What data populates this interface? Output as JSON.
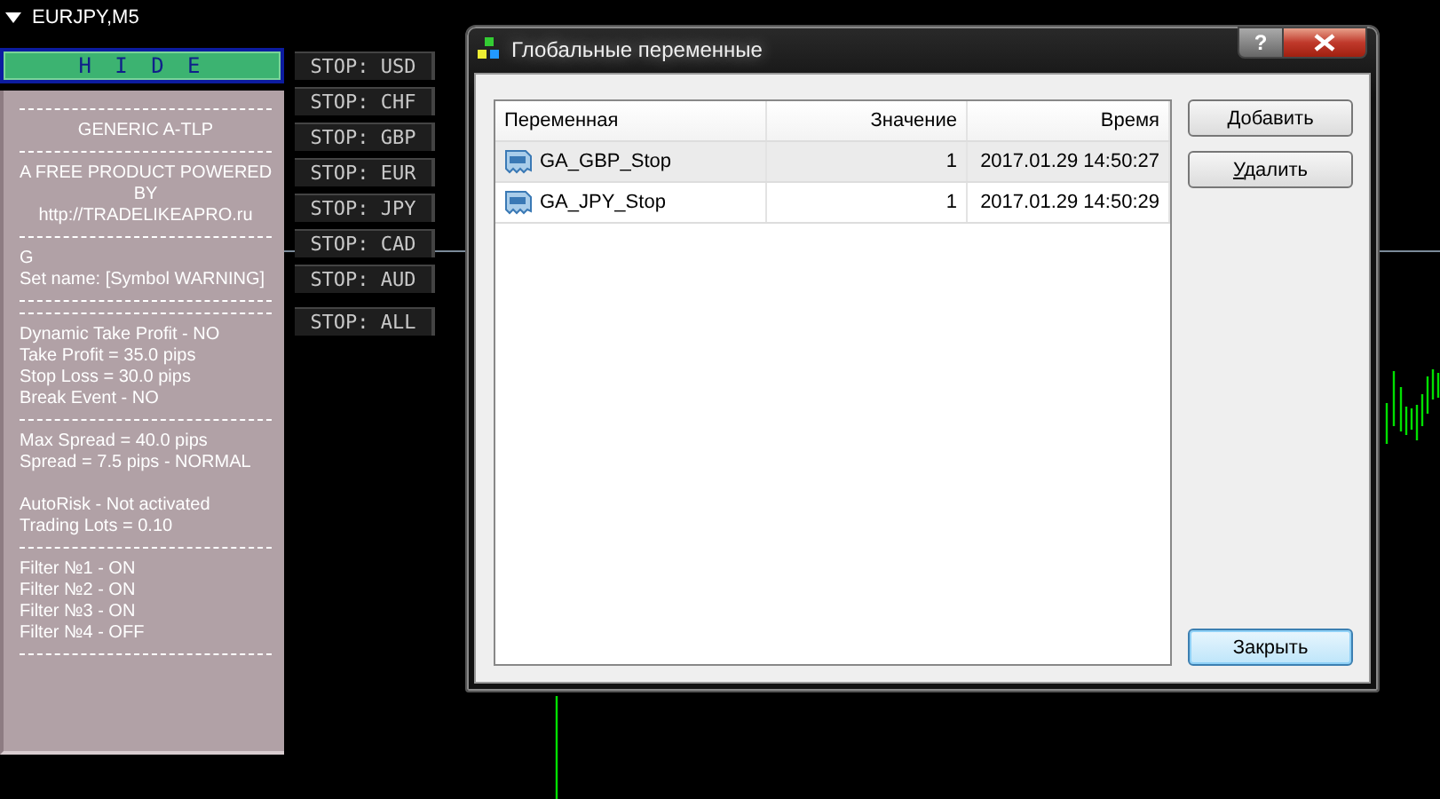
{
  "chart": {
    "title": "EURJPY,M5"
  },
  "hide_button": {
    "label": "H I D E"
  },
  "info_panel": {
    "lines": [
      {
        "kind": "rule"
      },
      {
        "kind": "center",
        "text": "GENERIC A-TLP"
      },
      {
        "kind": "rule"
      },
      {
        "kind": "center",
        "text": "A FREE PRODUCT POWERED"
      },
      {
        "kind": "center",
        "text": "BY"
      },
      {
        "kind": "center",
        "text": "http://TRADELIKEAPRO.ru"
      },
      {
        "kind": "rule"
      },
      {
        "kind": "left",
        "text": "G"
      },
      {
        "kind": "left",
        "text": "Set name: [Symbol WARNING]"
      },
      {
        "kind": "rule"
      },
      {
        "kind": "rule"
      },
      {
        "kind": "left",
        "text": "Dynamic Take Profit - NO"
      },
      {
        "kind": "left",
        "text": "Take Profit = 35.0 pips"
      },
      {
        "kind": "left",
        "text": "Stop Loss = 30.0 pips"
      },
      {
        "kind": "left",
        "text": "Break Event - NO"
      },
      {
        "kind": "rule"
      },
      {
        "kind": "left",
        "text": "Max Spread = 40.0 pips"
      },
      {
        "kind": "left",
        "text": "Spread = 7.5 pips - NORMAL"
      },
      {
        "kind": "blank"
      },
      {
        "kind": "left",
        "text": "AutoRisk - Not activated"
      },
      {
        "kind": "left",
        "text": "Trading Lots = 0.10"
      },
      {
        "kind": "rule"
      },
      {
        "kind": "left",
        "text": "Filter №1 - ON"
      },
      {
        "kind": "left",
        "text": "Filter №2 - ON"
      },
      {
        "kind": "left",
        "text": "Filter №3 - ON"
      },
      {
        "kind": "left",
        "text": "Filter №4 - OFF"
      },
      {
        "kind": "rule"
      }
    ]
  },
  "stop_buttons": [
    "STOP: USD",
    "STOP: CHF",
    "STOP: GBP",
    "STOP: EUR",
    "STOP: JPY",
    "STOP: CAD",
    "STOP: AUD",
    "STOP: ALL"
  ],
  "dialog": {
    "title": "Глобальные переменные",
    "help_button": "?",
    "table": {
      "columns": [
        "Переменная",
        "Значение",
        "Время"
      ],
      "rows": [
        {
          "name": "GA_GBP_Stop",
          "value": "1",
          "time": "2017.01.29 14:50:27",
          "selected": true
        },
        {
          "name": "GA_JPY_Stop",
          "value": "1",
          "time": "2017.01.29 14:50:29",
          "selected": false
        }
      ]
    },
    "buttons": [
      {
        "label": "Добавить",
        "kind": "normal"
      },
      {
        "label": "Удалить",
        "kind": "normal"
      },
      {
        "label": "Закрыть",
        "kind": "default"
      }
    ]
  }
}
